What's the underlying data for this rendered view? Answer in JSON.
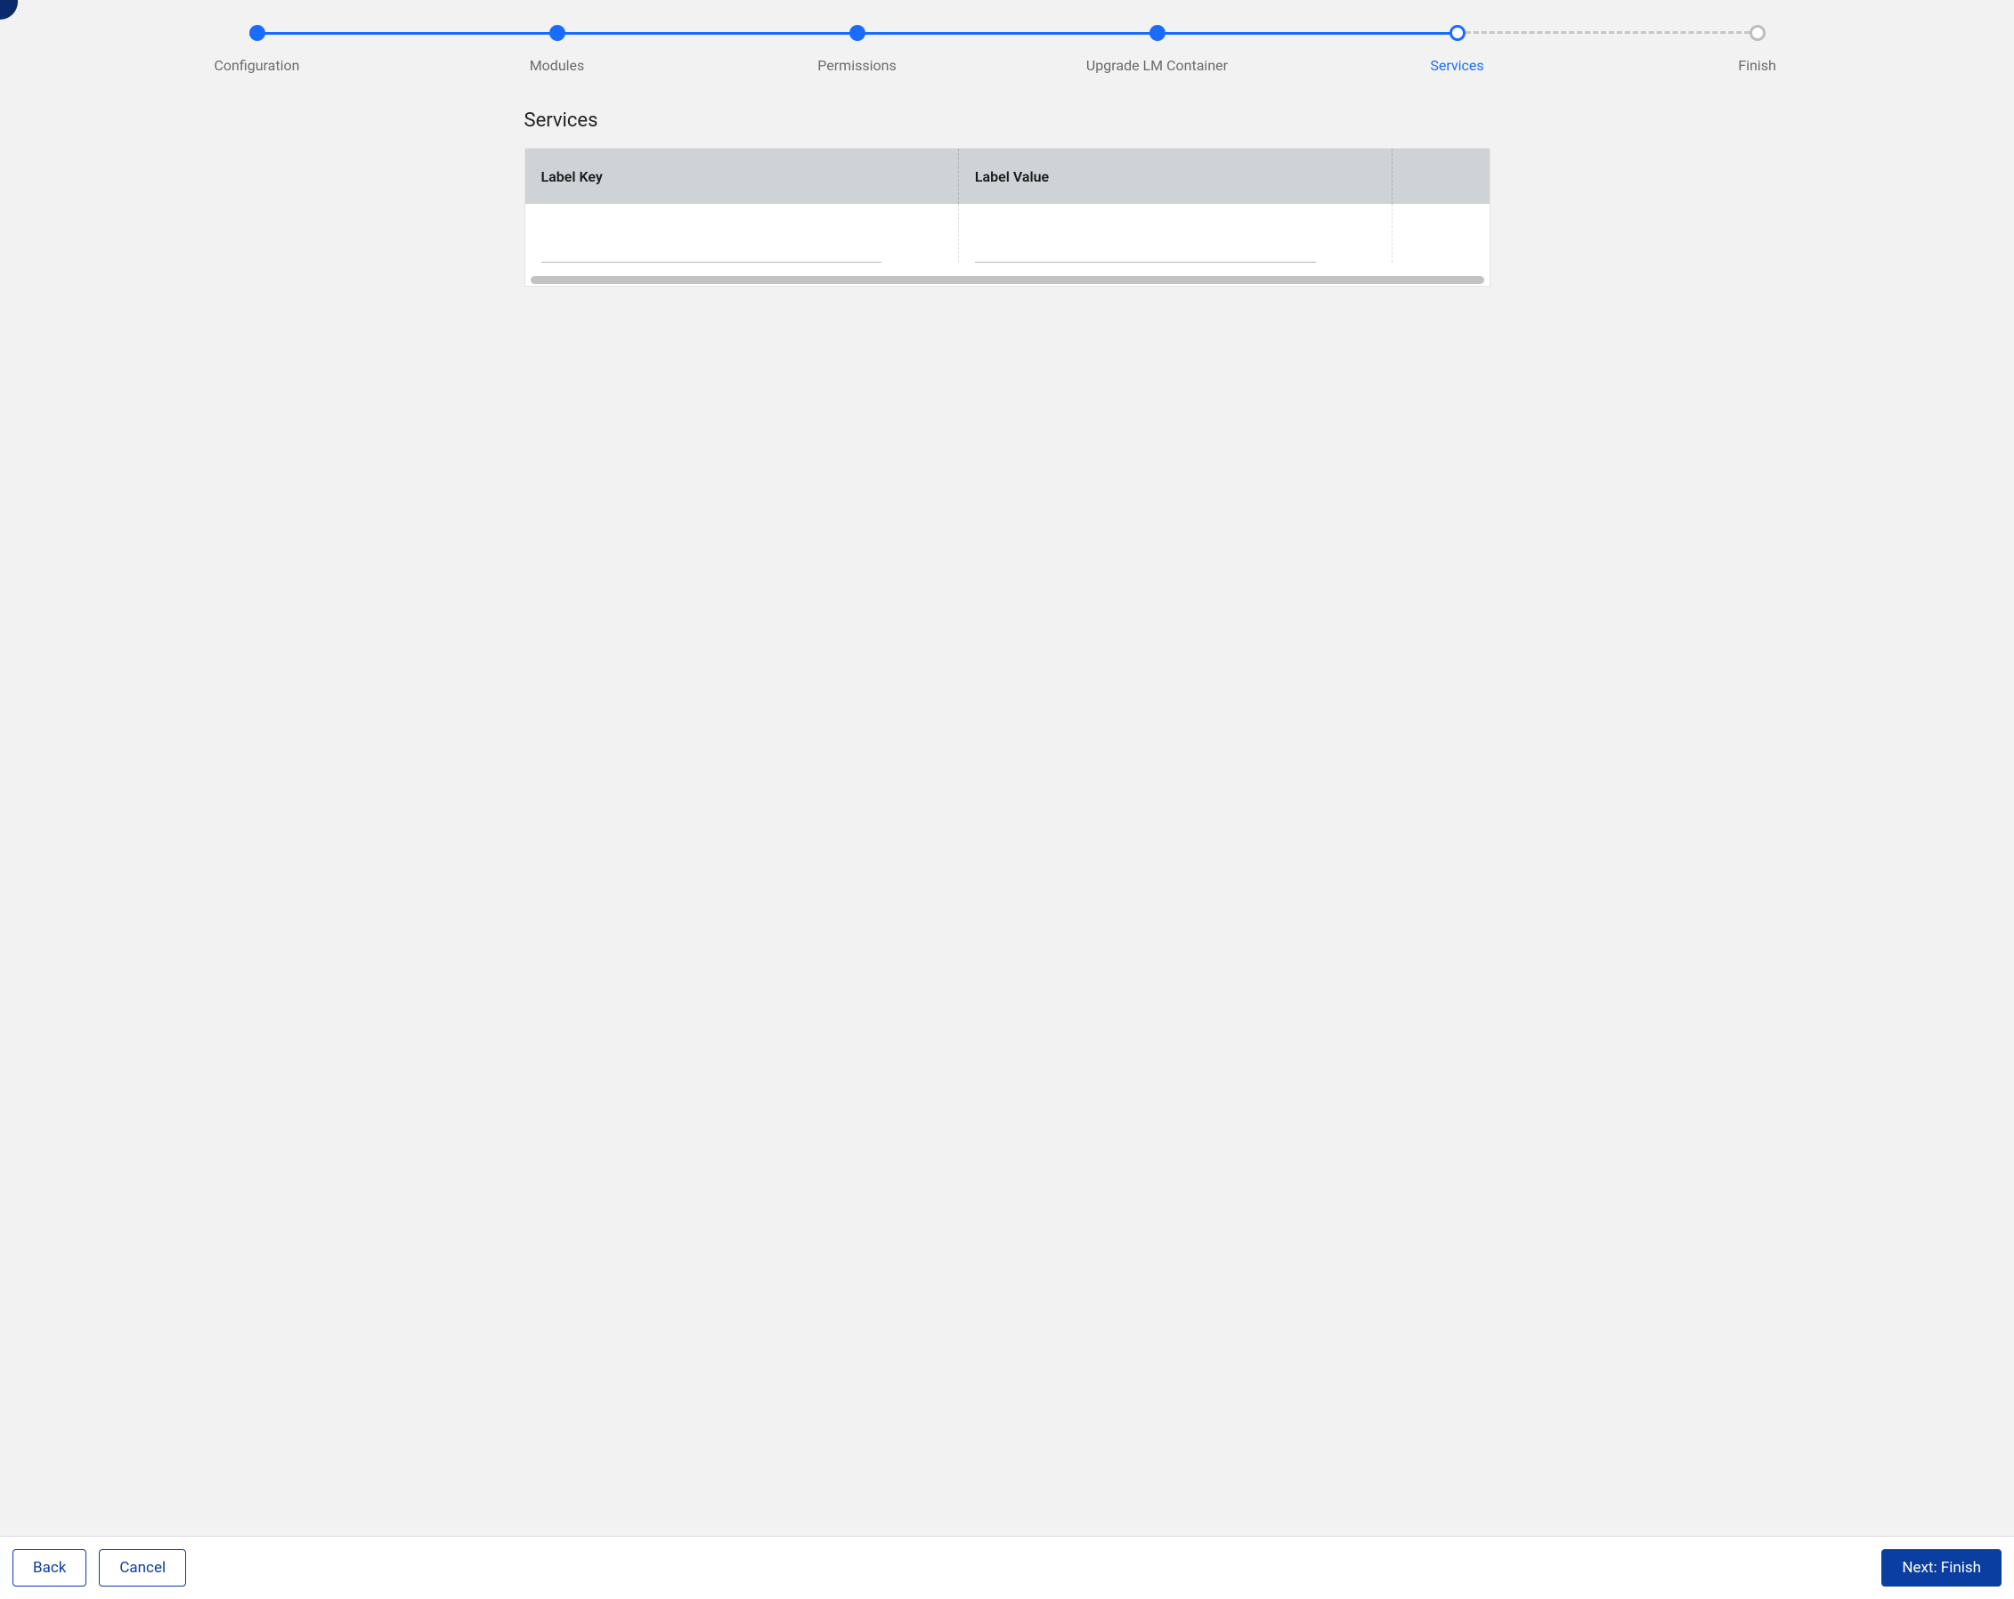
{
  "stepper": {
    "steps": [
      {
        "label": "Configuration",
        "state": "done"
      },
      {
        "label": "Modules",
        "state": "done"
      },
      {
        "label": "Permissions",
        "state": "done"
      },
      {
        "label": "Upgrade LM Container",
        "state": "done"
      },
      {
        "label": "Services",
        "state": "current"
      },
      {
        "label": "Finish",
        "state": "future"
      }
    ]
  },
  "page": {
    "title": "Services"
  },
  "table": {
    "headers": {
      "key": "Label Key",
      "value": "Label Value"
    },
    "rows": [
      {
        "key": "",
        "value": ""
      }
    ]
  },
  "footer": {
    "back": "Back",
    "cancel": "Cancel",
    "next": "Next: Finish"
  }
}
